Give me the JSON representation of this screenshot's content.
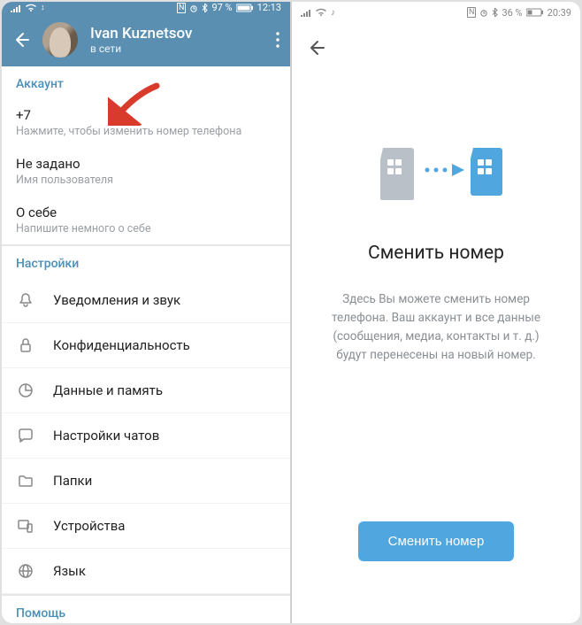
{
  "left": {
    "statusbar": {
      "battery": "97 %",
      "time": "12:13"
    },
    "header": {
      "name": "Ivan Kuznetsov",
      "status": "в сети"
    },
    "account": {
      "title": "Аккаунт",
      "phone": {
        "value": "+7",
        "hint": "Нажмите, чтобы изменить номер телефона"
      },
      "username": {
        "value": "Не задано",
        "hint": "Имя пользователя"
      },
      "bio": {
        "value": "О себе",
        "hint": "Напишите немного о себе"
      }
    },
    "settings": {
      "title": "Настройки",
      "items": [
        {
          "label": "Уведомления и звук",
          "icon": "bell-icon"
        },
        {
          "label": "Конфиденциальность",
          "icon": "lock-icon"
        },
        {
          "label": "Данные и память",
          "icon": "data-icon"
        },
        {
          "label": "Настройки чатов",
          "icon": "chat-icon"
        },
        {
          "label": "Папки",
          "icon": "folder-icon"
        },
        {
          "label": "Устройства",
          "icon": "devices-icon"
        },
        {
          "label": "Язык",
          "icon": "globe-icon"
        }
      ]
    },
    "help": {
      "title": "Помощь"
    }
  },
  "right": {
    "statusbar": {
      "battery": "36 %",
      "time": "20:39"
    },
    "title": "Сменить номер",
    "description": "Здесь Вы можете сменить номер телефона. Ваш аккаунт и все данные (сообщения, медиа, контакты и т. д.) будут перенесены на новый номер.",
    "button": "Сменить номер"
  }
}
